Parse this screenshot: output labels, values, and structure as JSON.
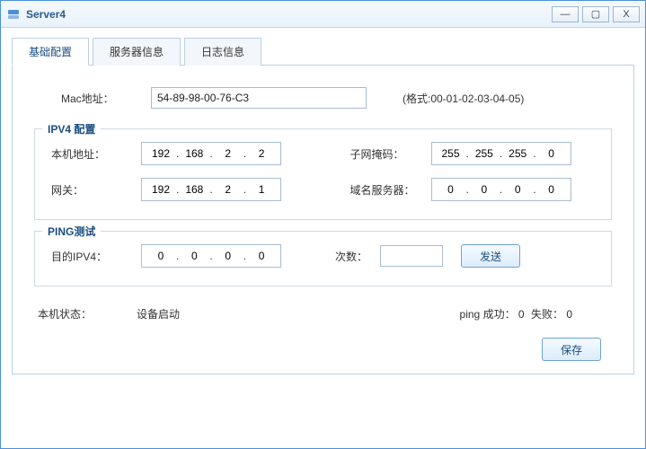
{
  "window": {
    "title": "Server4"
  },
  "tabs": {
    "basic": "基础配置",
    "server": "服务器信息",
    "log": "日志信息"
  },
  "mac": {
    "label": "Mac地址：",
    "value": "54-89-98-00-76-C3",
    "hint": "(格式:00-01-02-03-04-05)"
  },
  "ipv4": {
    "legend": "IPV4 配置",
    "hostLabel": "本机地址：",
    "host": [
      "192",
      "168",
      "2",
      "2"
    ],
    "maskLabel": "子网掩码：",
    "mask": [
      "255",
      "255",
      "255",
      "0"
    ],
    "gwLabel": "网关：",
    "gw": [
      "192",
      "168",
      "2",
      "1"
    ],
    "dnsLabel": "域名服务器：",
    "dns": [
      "0",
      "0",
      "0",
      "0"
    ]
  },
  "ping": {
    "legend": "PING测试",
    "targetLabel": "目的IPV4：",
    "target": [
      "0",
      "0",
      "0",
      "0"
    ],
    "countLabel": "次数：",
    "countValue": "",
    "sendLabel": "发送"
  },
  "status": {
    "stateLabel": "本机状态：",
    "stateValue": "设备启动",
    "pingPrefix": "ping 成功：",
    "succ": "0",
    "failPrefix": "失败：",
    "fail": "0"
  },
  "footer": {
    "save": "保存"
  }
}
